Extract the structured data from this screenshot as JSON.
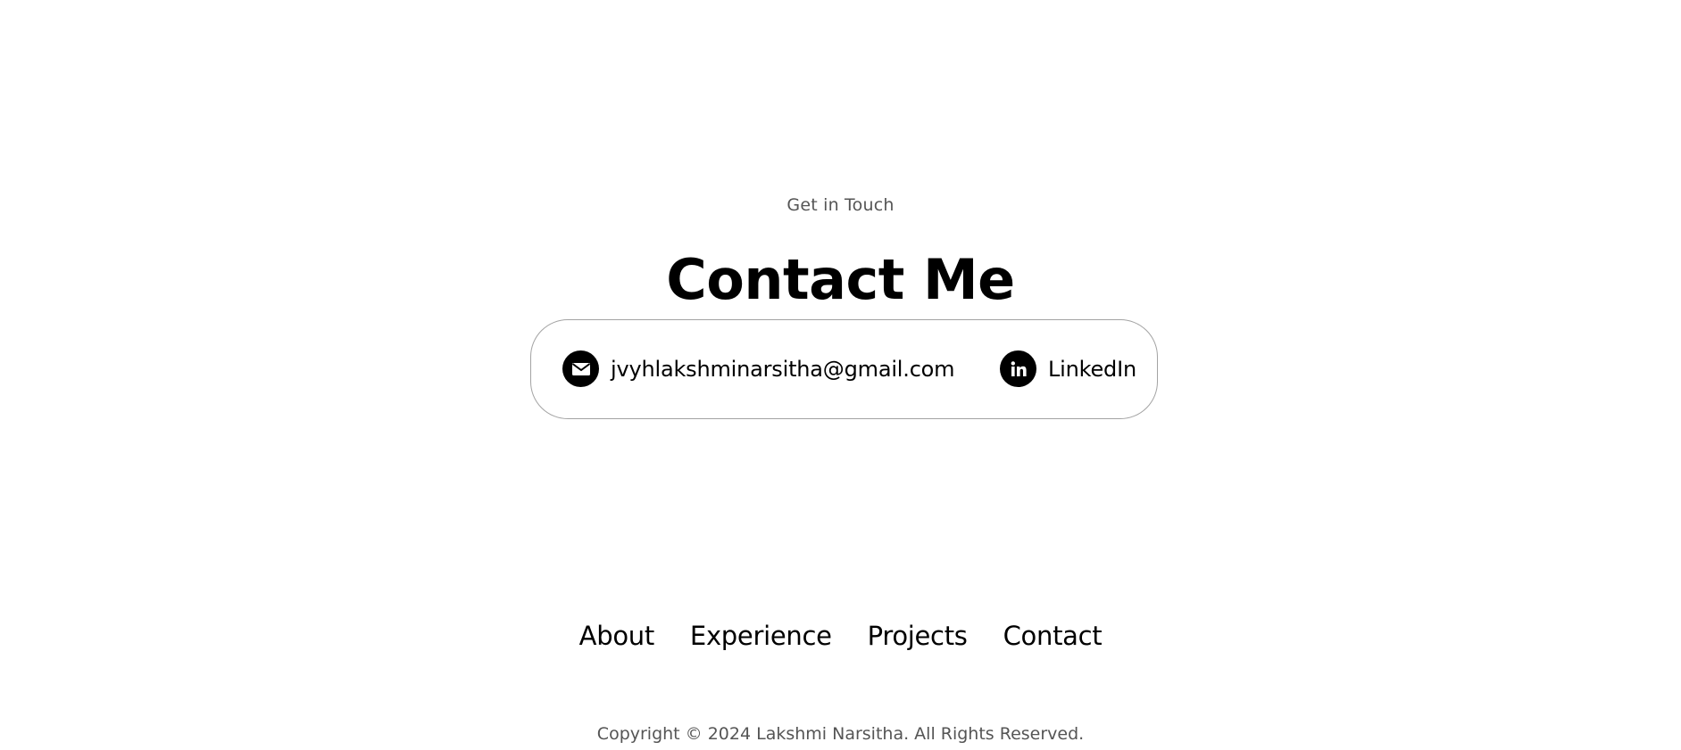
{
  "contact_section": {
    "subtitle": "Get in Touch",
    "title": "Contact Me",
    "email": {
      "icon": "mail-icon",
      "text": "jvyhlakshminarsitha@gmail.com"
    },
    "linkedin": {
      "icon": "linkedin-icon",
      "text": "LinkedIn"
    }
  },
  "footer": {
    "nav": [
      {
        "label": "About"
      },
      {
        "label": "Experience"
      },
      {
        "label": "Projects"
      },
      {
        "label": "Contact"
      }
    ],
    "copyright": "Copyright © 2024 Lakshmi Narsitha. All Rights Reserved."
  },
  "colors": {
    "text": "#000000",
    "muted_text": "#555555",
    "border": "#a3a3a3",
    "background": "#ffffff"
  }
}
